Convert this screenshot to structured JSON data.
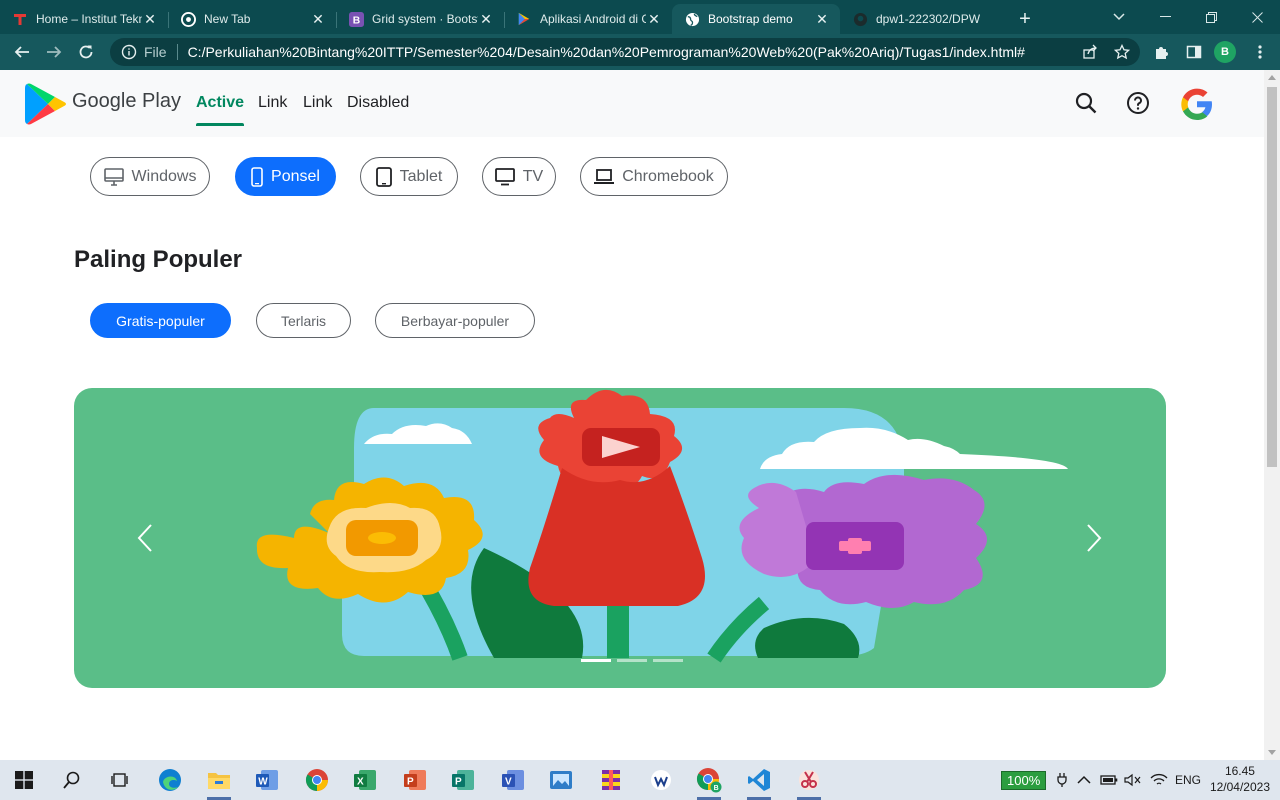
{
  "browser": {
    "tabs": [
      {
        "title": "Home – Institut Teknologi",
        "icon": "ittp-favicon",
        "active": false
      },
      {
        "title": "New Tab",
        "icon": "chrome-icon",
        "active": false
      },
      {
        "title": "Grid system · Bootstrap",
        "icon": "bootstrap-icon",
        "active": false
      },
      {
        "title": "Aplikasi Android di Google Play",
        "icon": "play-icon",
        "active": false
      },
      {
        "title": "Bootstrap demo",
        "icon": "globe-icon",
        "active": true
      },
      {
        "title": "dpw1-222302/DPW",
        "icon": "github-icon",
        "active": false
      }
    ],
    "new_tab_label": "+",
    "address": {
      "scheme_label": "File",
      "url": "C:/Perkuliahan%20Bintang%20ITTP/Semester%204/Desain%20dan%20Pemrograman%20Web%20(Pak%20Ariq)/Tugas1/index.html#"
    },
    "profile_initial": "B"
  },
  "navbar": {
    "brand": "Google Play",
    "links": [
      {
        "label": "Active",
        "active": true
      },
      {
        "label": "Link",
        "active": false
      },
      {
        "label": "Link",
        "active": false
      },
      {
        "label": "Disabled",
        "active": false
      }
    ],
    "icons": [
      "search-icon",
      "help-icon",
      "google-account-icon"
    ]
  },
  "devices": [
    {
      "label": "Windows",
      "icon": "monitor-icon",
      "selected": false
    },
    {
      "label": "Ponsel",
      "icon": "phone-icon",
      "selected": true
    },
    {
      "label": "Tablet",
      "icon": "tablet-icon",
      "selected": false
    },
    {
      "label": "TV",
      "icon": "tv-icon",
      "selected": false
    },
    {
      "label": "Chromebook",
      "icon": "laptop-icon",
      "selected": false
    }
  ],
  "section": {
    "title": "Paling Populer",
    "filters": [
      {
        "label": "Gratis-populer",
        "selected": true
      },
      {
        "label": "Terlaris",
        "selected": false
      },
      {
        "label": "Berbayar-populer",
        "selected": false
      }
    ]
  },
  "carousel": {
    "slide_count": 3,
    "active_slide": 1,
    "prev_icon": "chevron-left-icon",
    "next_icon": "chevron-right-icon"
  },
  "taskbar": {
    "apps": [
      "start-icon",
      "search-icon",
      "task-view-icon",
      "edge-icon",
      "file-explorer-icon",
      "word-icon",
      "chrome-icon",
      "excel-icon",
      "powerpoint-icon",
      "publisher-icon",
      "visio-icon",
      "photos-icon",
      "winrar-icon",
      "wps-icon",
      "chrome-profile-icon",
      "vscode-icon",
      "snipping-tool-icon"
    ],
    "battery": "100%",
    "language": "ENG",
    "time": "16.45",
    "date": "12/04/2023"
  },
  "colors": {
    "chrome_frame": "#0c4a4f",
    "chrome_toolbar": "#16585d",
    "play_green": "#01875f",
    "primary_blue": "#0d6efd",
    "carousel_bg": "#5abe88"
  }
}
